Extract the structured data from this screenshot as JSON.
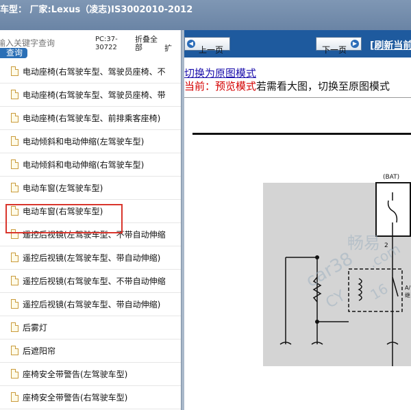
{
  "window": {
    "title": "车型： 厂家:Lexus（凌志)IS3002010-2012"
  },
  "sidebar": {
    "search_placeholder": "输入关键字查询",
    "search_button": "查询",
    "pc_code": "PC:37-30722",
    "fold_all": "折叠全部",
    "expand_partial": "扩",
    "items": [
      {
        "label": "电动座椅(右驾驶车型、驾驶员座椅、不"
      },
      {
        "label": "电动座椅(右驾驶车型、驾驶员座椅、带"
      },
      {
        "label": "电动座椅(右驾驶车型、前排乘客座椅)"
      },
      {
        "label": "电动倾斜和电动伸缩(左驾驶车型)"
      },
      {
        "label": "电动倾斜和电动伸缩(右驾驶车型)"
      },
      {
        "label": "电动车窗(左驾驶车型)"
      },
      {
        "label": "电动车窗(右驾驶车型)"
      },
      {
        "label": "遥控后视镜(左驾驶车型、不带自动伸缩"
      },
      {
        "label": "遥控后视镜(左驾驶车型、带自动伸缩)"
      },
      {
        "label": "遥控后视镜(右驾驶车型、不带自动伸缩"
      },
      {
        "label": "遥控后视镜(右驾驶车型、带自动伸缩)"
      },
      {
        "label": "后雾灯"
      },
      {
        "label": "后遮阳帘"
      },
      {
        "label": "座椅安全带警告(左驾驶车型)"
      },
      {
        "label": "座椅安全带警告(右驾驶车型)"
      }
    ]
  },
  "toolbar": {
    "prev_label": "上一页",
    "next_label": "下一页",
    "refresh_label": "[刷新当前"
  },
  "viewer": {
    "switch_link": "切换为原图模式",
    "mode_current": "当前：预览模式",
    "mode_hint": "若需看大图，切换至原图模式"
  },
  "diagram": {
    "bat_label": "(BAT)",
    "pin_label": "2",
    "side_label_1": "A/",
    "side_label_2": "继",
    "watermark_1": "畅易",
    "watermark_2": "car38",
    "watermark_3": ".com",
    "watermark_4": "CY",
    "watermark_5": "16"
  },
  "colors": {
    "nav_blue": "#1e5a9e",
    "title_bar": "#7891b0",
    "highlight_red": "#d9342b",
    "diagram_gray": "#d4d4d4"
  }
}
